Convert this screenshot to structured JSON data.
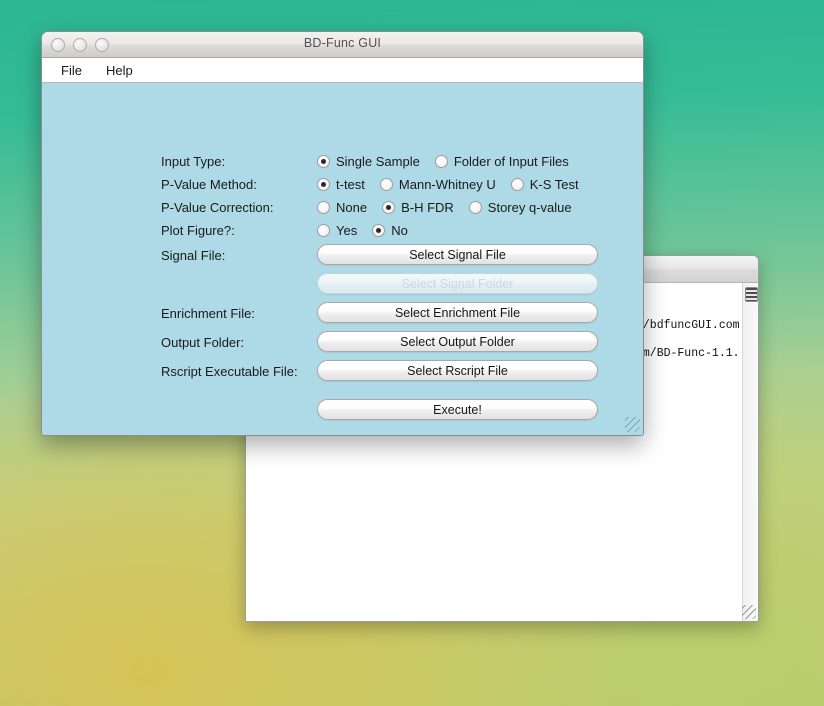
{
  "window": {
    "title": "BD-Func GUI",
    "traffic_lights": [
      "close-button",
      "minimize-button",
      "zoom-button"
    ],
    "menu": [
      {
        "label": "File"
      },
      {
        "label": "Help"
      }
    ]
  },
  "form": {
    "rows": [
      {
        "label": "Input Type:",
        "options": [
          {
            "label": "Single Sample",
            "checked": true
          },
          {
            "label": "Folder of Input Files",
            "checked": false
          }
        ]
      },
      {
        "label": "P-Value Method:",
        "options": [
          {
            "label": "t-test",
            "checked": true
          },
          {
            "label": "Mann-Whitney U",
            "checked": false
          },
          {
            "label": "K-S Test",
            "checked": false
          }
        ]
      },
      {
        "label": "P-Value Correction:",
        "options": [
          {
            "label": "None",
            "checked": false
          },
          {
            "label": "B-H FDR",
            "checked": true
          },
          {
            "label": "Storey q-value",
            "checked": false
          }
        ]
      },
      {
        "label": "Plot Figure?:",
        "options": [
          {
            "label": "Yes",
            "checked": false
          },
          {
            "label": "No",
            "checked": true
          }
        ]
      }
    ],
    "file_rows": [
      {
        "label": "Signal File:",
        "button": "Select Signal File",
        "disabled": false
      },
      {
        "label": "",
        "button": "Select Signal Folder",
        "disabled": true
      },
      {
        "label": "Enrichment File:",
        "button": "Select Enrichment File",
        "disabled": false
      },
      {
        "label": "Output Folder:",
        "button": "Select Output Folder",
        "disabled": false
      },
      {
        "label": "Rscript Executable File:",
        "button": "Select Rscript File",
        "disabled": false
      }
    ],
    "execute_button": "Execute!"
  },
  "background_window": {
    "lines": [
      "n/bdfuncGUI.com",
      "hm/BD-Func-1.1."
    ]
  },
  "colors": {
    "panel_background": "#aed9e6",
    "titlebar": "#e7e4e4",
    "menubar": "#ffffff",
    "text": "#1b1b1b",
    "disabled_text": "#c4dbe4",
    "desktop_top": "#2cb693",
    "desktop_bottom": "#c4cc7e"
  }
}
